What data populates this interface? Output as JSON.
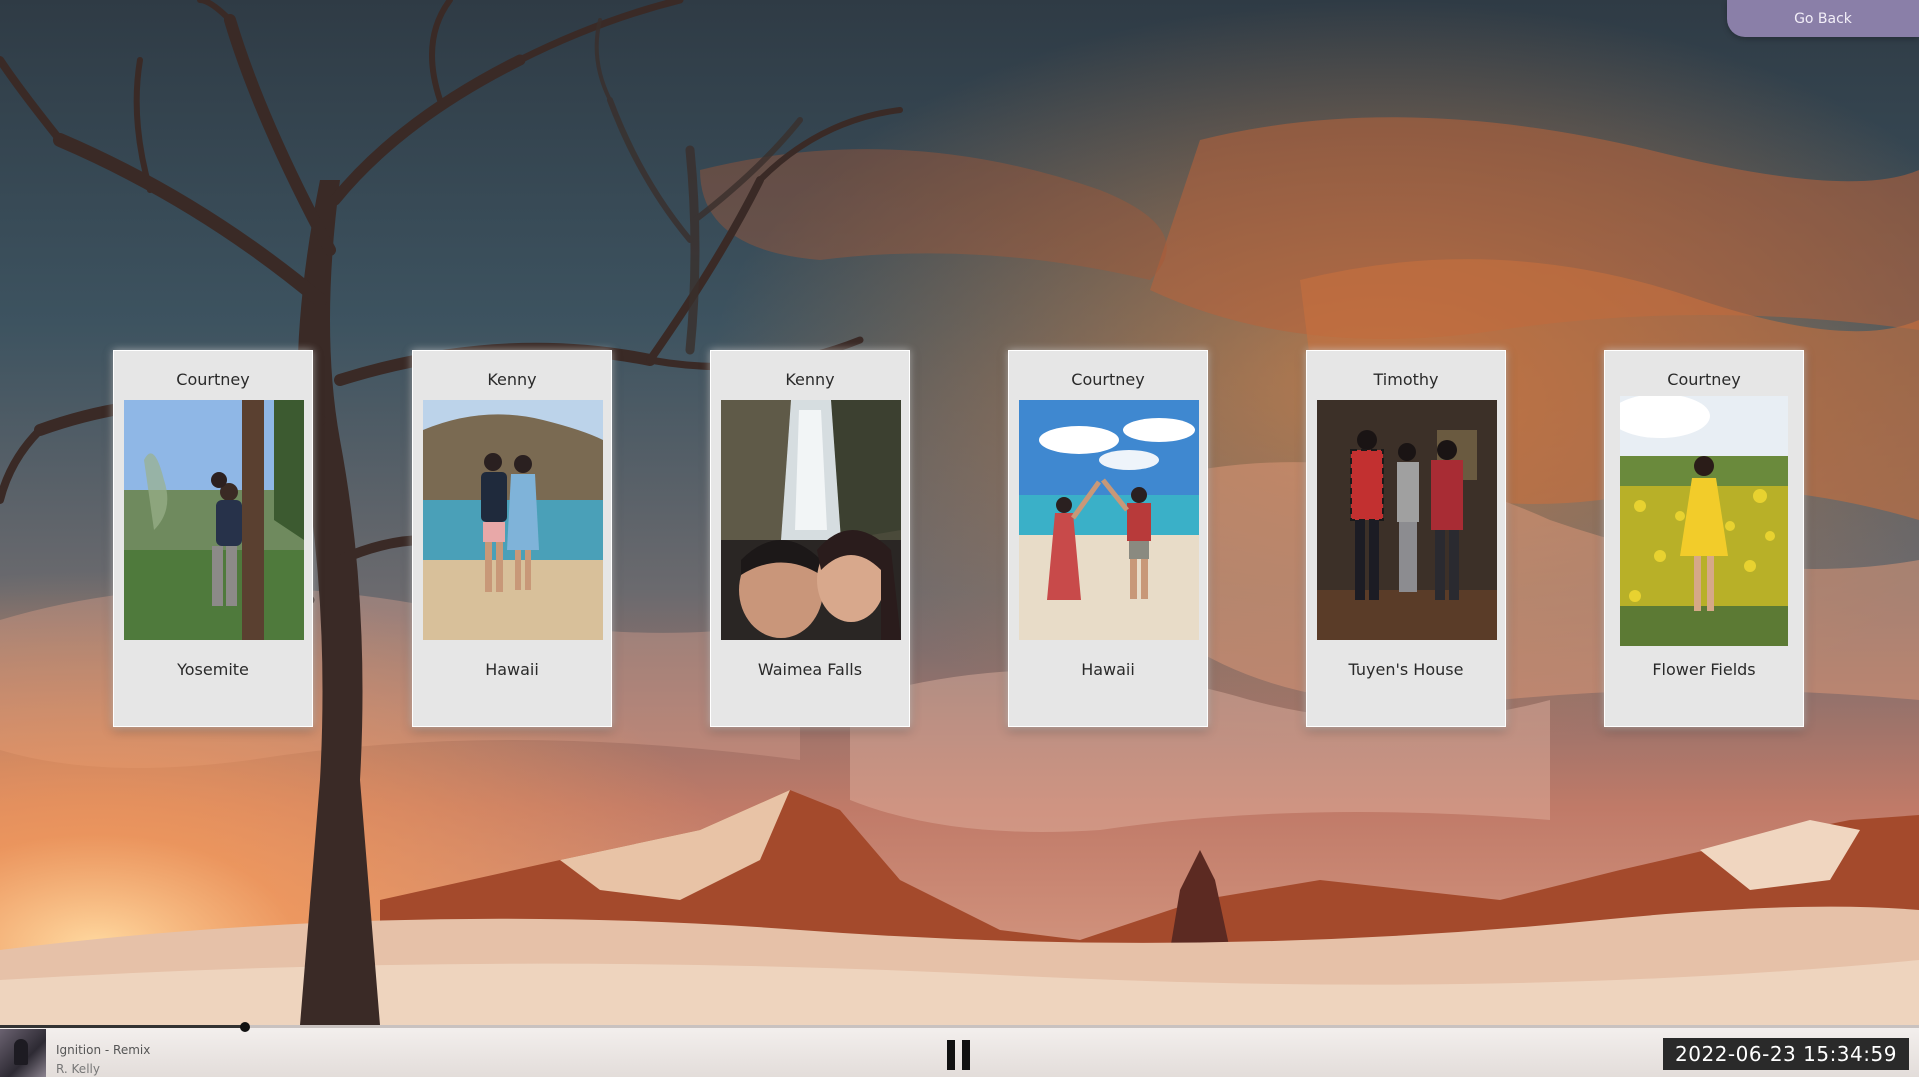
{
  "header": {
    "go_back_label": "Go Back"
  },
  "cards": [
    {
      "name": "Courtney",
      "place": "Yosemite",
      "photo_icon": "yosemite-photo"
    },
    {
      "name": "Kenny",
      "place": "Hawaii",
      "photo_icon": "hawaii-beach-photo"
    },
    {
      "name": "Kenny",
      "place": "Waimea Falls",
      "photo_icon": "waterfall-photo"
    },
    {
      "name": "Courtney",
      "place": "Hawaii",
      "photo_icon": "hawaii-dance-photo"
    },
    {
      "name": "Timothy",
      "place": "Tuyen's House",
      "photo_icon": "house-photo"
    },
    {
      "name": "Courtney",
      "place": "Flower Fields",
      "photo_icon": "flower-field-photo"
    }
  ],
  "player": {
    "track_title": "Ignition - Remix",
    "track_artist": "R. Kelly",
    "progress_fraction": 0.127,
    "pause_icon": "pause-icon"
  },
  "status": {
    "timestamp": "2022-06-23  15:34:59"
  },
  "colors": {
    "go_back_bg": "#8a7fa8",
    "card_bg": "#e6e6e6",
    "timestamp_bg": "#2a2a2a"
  }
}
